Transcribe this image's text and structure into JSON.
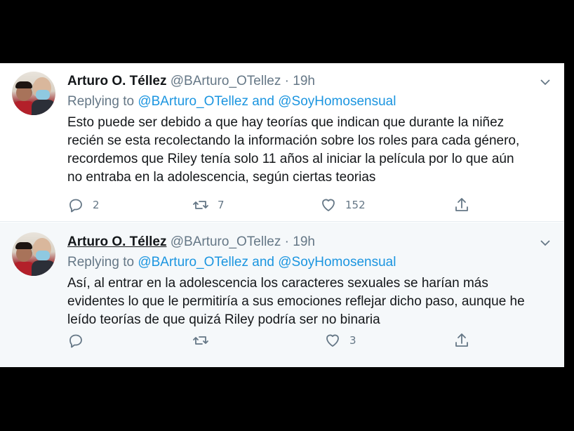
{
  "tweets": [
    {
      "author_name": "Arturo O. Téllez",
      "handle": "@BArturo_OTellez",
      "separator": "·",
      "time": "19h",
      "replying_prefix": "Replying to",
      "replying_to": [
        "@BArturo_OTellez",
        "@SoyHomosensual"
      ],
      "replying_joiner": "and",
      "body_lines": [
        "Esto puede ser debido a que hay teorías que indican que durante la niñez",
        "recién se esta recolectando la información sobre los roles para cada género,",
        "recordemos que Riley tenía solo 11 años al iniciar la película por lo que aún",
        "no entraba en la adolescencia, según ciertas teorias"
      ],
      "reply_count": "2",
      "retweet_count": "7",
      "like_count": "152",
      "icons": [
        "reply-icon",
        "retweet-icon",
        "like-icon",
        "share-icon",
        "chevron-down-icon"
      ]
    },
    {
      "author_name": "Arturo O. Téllez",
      "handle": "@BArturo_OTellez",
      "separator": "·",
      "time": "19h",
      "replying_prefix": "Replying to",
      "replying_to": [
        "@BArturo_OTellez",
        "@SoyHomosensual"
      ],
      "replying_joiner": "and",
      "body_lines": [
        "Así, al entrar en la adolescencia los caracteres sexuales se harían más",
        "evidentes lo que le permitiría a sus emociones reflejar dicho paso, aunque he",
        "leído teorías de que quizá Riley podría ser no binaria"
      ],
      "reply_count": "",
      "retweet_count": "",
      "like_count": "3",
      "icons": [
        "reply-icon",
        "retweet-icon",
        "like-icon",
        "share-icon",
        "chevron-down-icon"
      ]
    }
  ],
  "colors": {
    "background": "#000000",
    "card": "#ffffff",
    "card_alt": "#f5f8fa",
    "text": "#14171a",
    "muted": "#657786",
    "link": "#1b95e0"
  }
}
